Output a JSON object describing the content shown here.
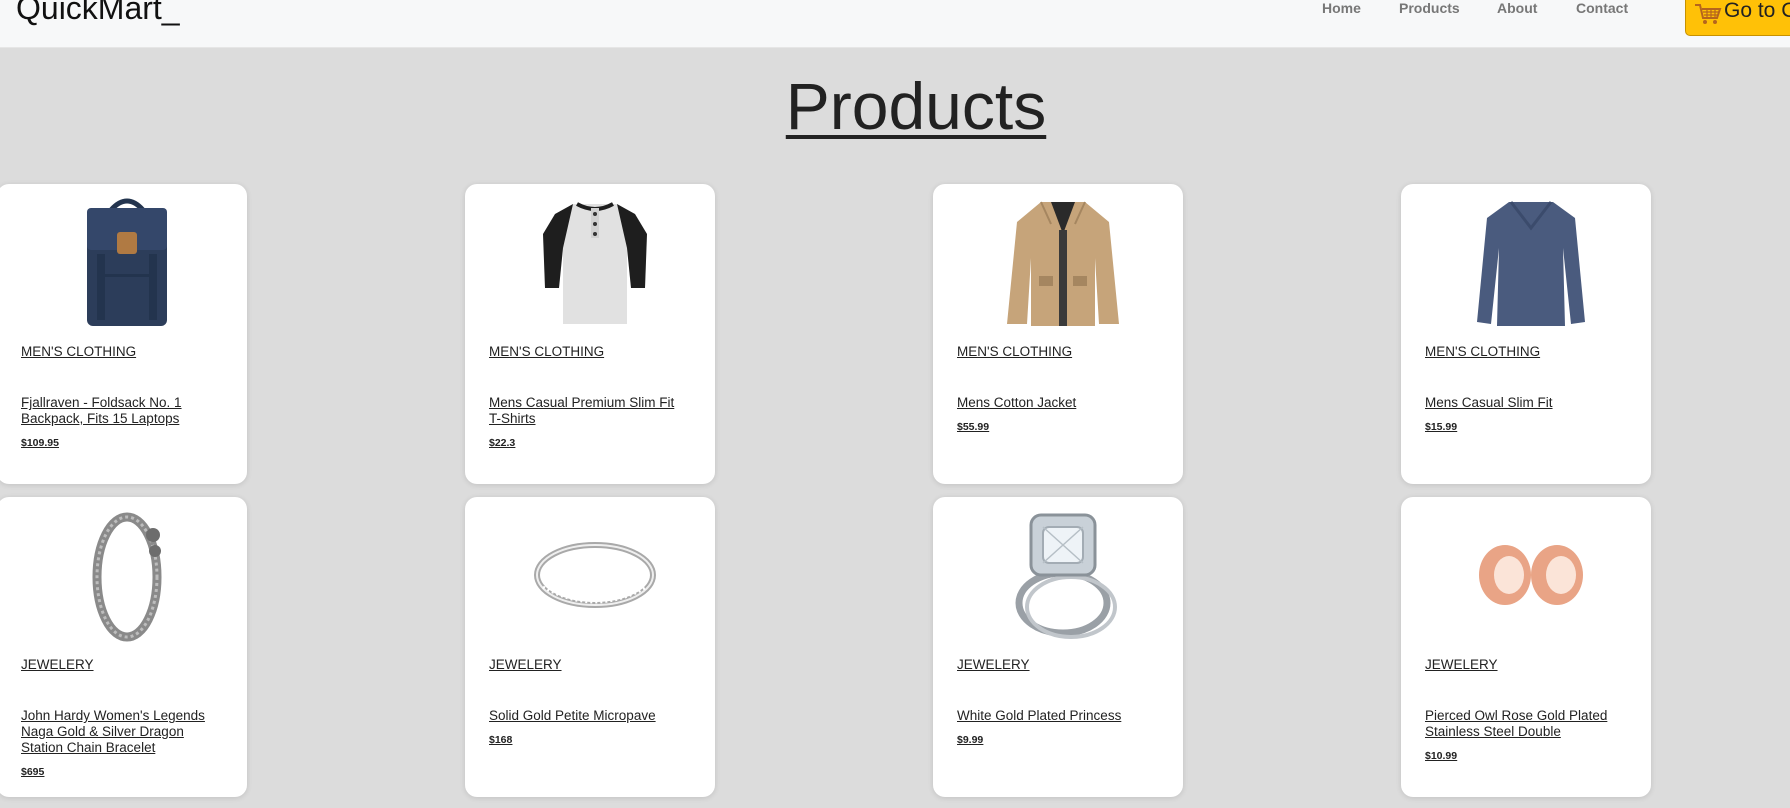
{
  "navbar": {
    "brand": "QuickMart_",
    "links": [
      "Home",
      "Products",
      "About",
      "Contact"
    ],
    "cart_button": "Go to Cart",
    "cart_icon": "shopping-cart-icon"
  },
  "page": {
    "title": "Products"
  },
  "products": [
    {
      "category": "MEN'S CLOTHING",
      "title": "Fjallraven - Foldsack No. 1 Backpack, Fits 15 Laptops",
      "price": "$109.95",
      "image": "backpack"
    },
    {
      "category": "MEN'S CLOTHING",
      "title": "Mens Casual Premium Slim Fit T-Shirts",
      "price": "$22.3",
      "image": "henley-shirt"
    },
    {
      "category": "MEN'S CLOTHING",
      "title": "Mens Cotton Jacket",
      "price": "$55.99",
      "image": "jacket"
    },
    {
      "category": "MEN'S CLOTHING",
      "title": "Mens Casual Slim Fit",
      "price": "$15.99",
      "image": "long-sleeve-shirt"
    },
    {
      "category": "JEWELERY",
      "title": "John Hardy Women's Legends Naga Gold & Silver Dragon Station Chain Bracelet",
      "price": "$695",
      "image": "dragon-bracelet"
    },
    {
      "category": "JEWELERY",
      "title": "Solid Gold Petite Micropave",
      "price": "$168",
      "image": "silver-ring"
    },
    {
      "category": "JEWELERY",
      "title": "White Gold Plated Princess",
      "price": "$9.99",
      "image": "diamond-ring"
    },
    {
      "category": "JEWELERY",
      "title": "Pierced Owl Rose Gold Plated Stainless Steel Double",
      "price": "$10.99",
      "image": "rose-gold-tunnels"
    }
  ],
  "colors": {
    "background": "#dcdcdc",
    "navbar": "#f7f8f9",
    "cart_button": "#ffc107",
    "card": "#ffffff"
  }
}
